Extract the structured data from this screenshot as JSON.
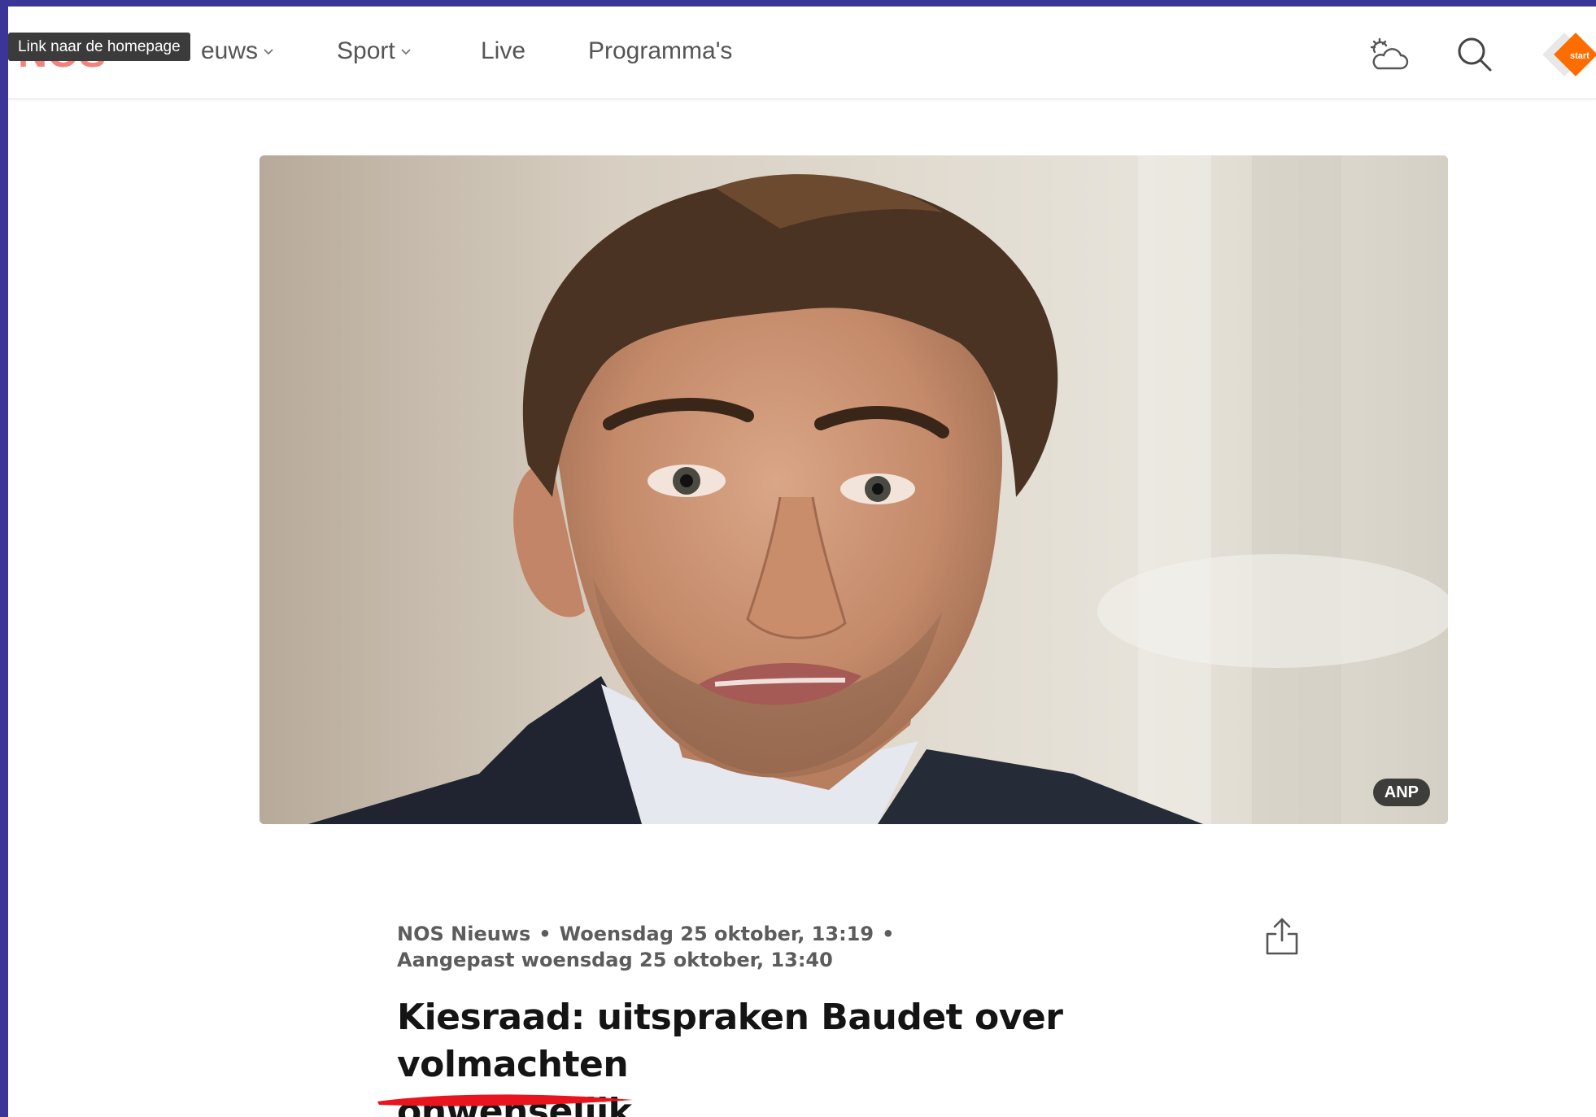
{
  "header": {
    "logo_text": "NOS",
    "tooltip": "Link naar de homepage",
    "nav": [
      {
        "label": "Nieuws",
        "visible_label": "euws",
        "has_dropdown": true
      },
      {
        "label": "Sport",
        "has_dropdown": true
      },
      {
        "label": "Live",
        "has_dropdown": false
      },
      {
        "label": "Programma's",
        "has_dropdown": false
      }
    ],
    "icons": [
      "weather-icon",
      "search-icon",
      "nos-start-icon"
    ],
    "nos_start_text": "start"
  },
  "hero": {
    "credit": "ANP"
  },
  "article": {
    "source": "NOS Nieuws",
    "published": "Woensdag 25 oktober, 13:19",
    "updated": "Aangepast woensdag 25 oktober, 13:40",
    "headline_line1": "Kiesraad: uitspraken Baudet over volmachten",
    "headline_line2": "onwenselijk"
  },
  "colors": {
    "frame": "#3a3596",
    "nos_red": "#e61e14",
    "nos_orange": "#ff6d00",
    "underline_red": "#e8141e",
    "text_dark": "#141414",
    "text_meta": "#5c5c5c"
  }
}
